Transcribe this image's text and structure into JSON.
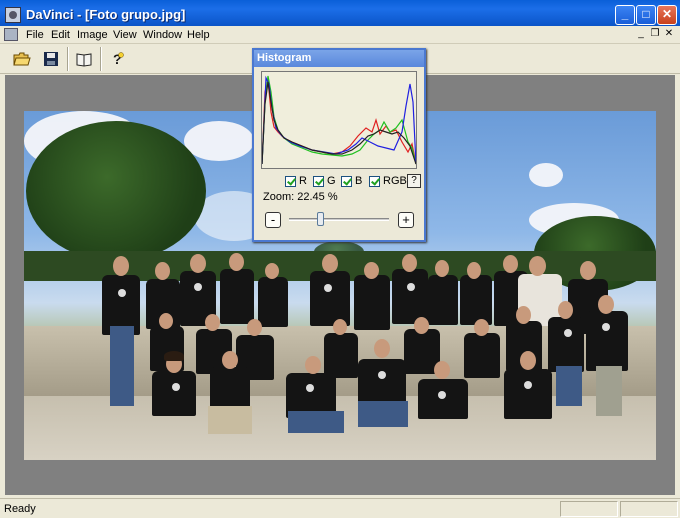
{
  "window": {
    "title": "DaVinci - [Foto grupo.jpg]",
    "minimize_label": "_",
    "maximize_label": "□",
    "close_label": "✕"
  },
  "menu": {
    "items": [
      "File",
      "Edit",
      "Image",
      "View",
      "Window",
      "Help"
    ],
    "mdi_minimize": "_",
    "mdi_restore": "❐",
    "mdi_close": "✕"
  },
  "toolbar": {
    "buttons": [
      {
        "icon": "open-folder-icon"
      },
      {
        "icon": "save-disk-icon"
      },
      {
        "icon": "book-icon"
      },
      {
        "icon": "help-lightbulb-icon"
      }
    ]
  },
  "histogram": {
    "title": "Histogram",
    "channels": [
      {
        "label": "R",
        "checked": true,
        "color": "#e02020"
      },
      {
        "label": "G",
        "checked": true,
        "color": "#20c020"
      },
      {
        "label": "B",
        "checked": true,
        "color": "#2020e0"
      },
      {
        "label": "RGB",
        "checked": true,
        "color": "#222222"
      }
    ],
    "help_label": "?",
    "zoom_label": "Zoom:",
    "zoom_value": "22.45 %",
    "zoom_out_label": "-",
    "zoom_in_label": "+"
  },
  "status": {
    "text": "Ready"
  }
}
